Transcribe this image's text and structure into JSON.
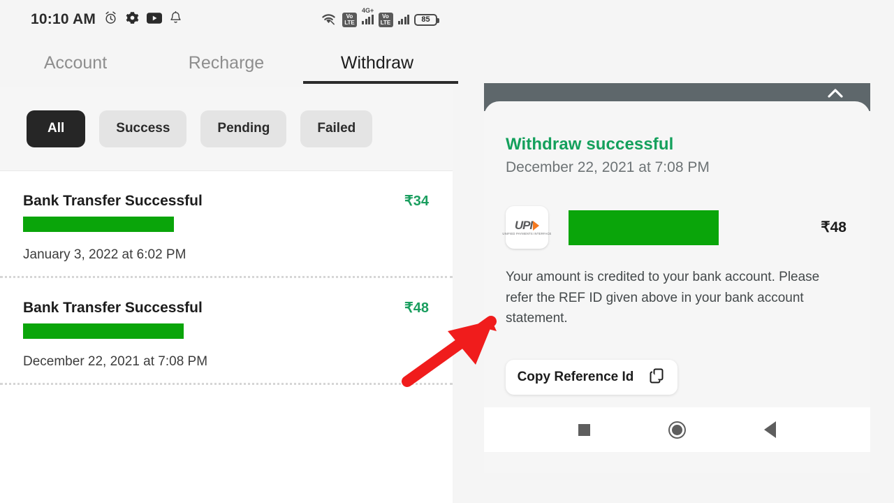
{
  "status_bar": {
    "time": "10:10 AM",
    "left_icons": [
      "alarm-clock-icon",
      "gear-icon",
      "youtube-icon",
      "bell-icon"
    ],
    "wifi": "wifi-icon",
    "volte_label_top": "Vo",
    "volte_label_bottom": "LTE",
    "network_label": "4G+",
    "battery_percent": "85"
  },
  "tabs": [
    {
      "label": "Account",
      "active": false
    },
    {
      "label": "Recharge",
      "active": false
    },
    {
      "label": "Withdraw",
      "active": true
    }
  ],
  "filters": [
    {
      "label": "All",
      "selected": true
    },
    {
      "label": "Success",
      "selected": false
    },
    {
      "label": "Pending",
      "selected": false
    },
    {
      "label": "Failed",
      "selected": false
    }
  ],
  "transactions": [
    {
      "title": "Bank Transfer Successful",
      "amount": "₹34",
      "date": "January 3, 2022 at 6:02 PM",
      "redacted_width": 216
    },
    {
      "title": "Bank Transfer Successful",
      "amount": "₹48",
      "date": "December 22, 2021 at 7:08 PM",
      "redacted_width": 230
    }
  ],
  "modal": {
    "close_icon": "close-icon",
    "title": "Withdraw successful",
    "date": "December 22, 2021 at 7:08 PM",
    "payment_method_icon": "upi-logo-icon",
    "upi_wordmark": "UPI",
    "upi_subtitle": "UNIFIED PAYMENTS INTERFACE",
    "amount": "₹48",
    "body": "Your amount is credited to your bank account. Please refer the REF ID given above in your bank account statement.",
    "copy_button_label": "Copy Reference Id",
    "copy_button_icon": "copy-icon"
  },
  "nav_bar": {
    "recents": "square-recents-icon",
    "home": "circle-home-icon",
    "back": "triangle-back-icon"
  },
  "annotation": {
    "type": "arrow",
    "color": "#f01c1c",
    "points_to": "copy-reference-id-button"
  },
  "colors": {
    "accent_green": "#14a05c",
    "redaction_green": "#0aa50a",
    "amount_green": "#1a9e5f",
    "chip_selected_bg": "#262626",
    "scrim": "#5e676b"
  }
}
